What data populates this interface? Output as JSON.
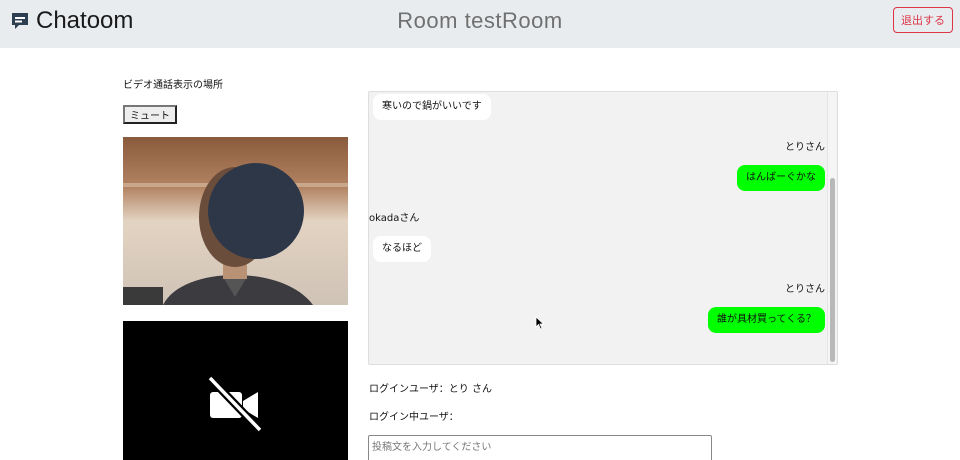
{
  "header": {
    "brand": "Chatoom",
    "room_title": "Room testRoom",
    "logout_label": "退出する"
  },
  "video": {
    "section_label": "ビデオ通話表示の場所",
    "mute_label": "ミュート"
  },
  "chat": {
    "messages": [
      {
        "side": "left",
        "text": "寒いので鍋がいいです"
      },
      {
        "side": "right",
        "sender": "とりさん",
        "text": "はんばーぐかな"
      },
      {
        "side": "left",
        "sender": "okadaさん",
        "text": "なるほど"
      },
      {
        "side": "right",
        "sender": "とりさん",
        "text": "誰が具材買ってくる？"
      }
    ]
  },
  "status": {
    "login_user": "ログインユーザ：とり さん",
    "online_users": "ログイン中ユーザ："
  },
  "composer": {
    "placeholder": "投稿文を入力してください"
  },
  "colors": {
    "accent_danger": "#dc3545",
    "own_bubble": "#00ff00",
    "other_bubble": "#ffffff",
    "header_bg": "#e9ecef"
  },
  "icons": {
    "brand": "chat-bubble-icon",
    "camera_off": "video-off-icon"
  }
}
